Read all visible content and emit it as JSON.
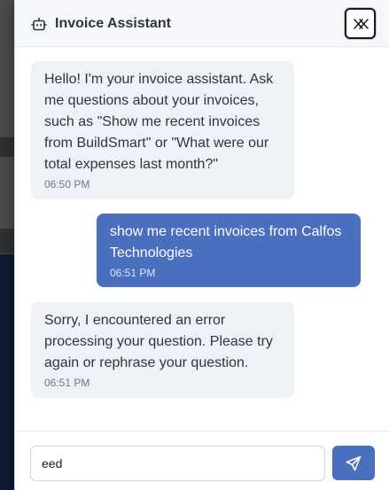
{
  "header": {
    "title": "Invoice Assistant",
    "bot_icon": "robot-icon",
    "close_icon": "close-icon"
  },
  "messages": [
    {
      "role": "assistant",
      "text": "Hello! I'm your invoice assistant. Ask me questions about your invoices, such as \"Show me recent invoices from BuildSmart\" or \"What were our total expenses last month?\"",
      "time": "06:50 PM"
    },
    {
      "role": "user",
      "text": "show me recent invoices from Calfos Technologies",
      "time": "06:51 PM"
    },
    {
      "role": "assistant",
      "text": "Sorry, I encountered an error processing your question. Please try again or rephrase your question.",
      "time": "06:51 PM"
    }
  ],
  "composer": {
    "input_value": "eed",
    "send_icon": "send-icon"
  },
  "colors": {
    "accent": "#4b6fbf",
    "assistant_bubble": "#eef1f6",
    "header_bg": "#f5f7fa",
    "text": "#2d3442"
  }
}
